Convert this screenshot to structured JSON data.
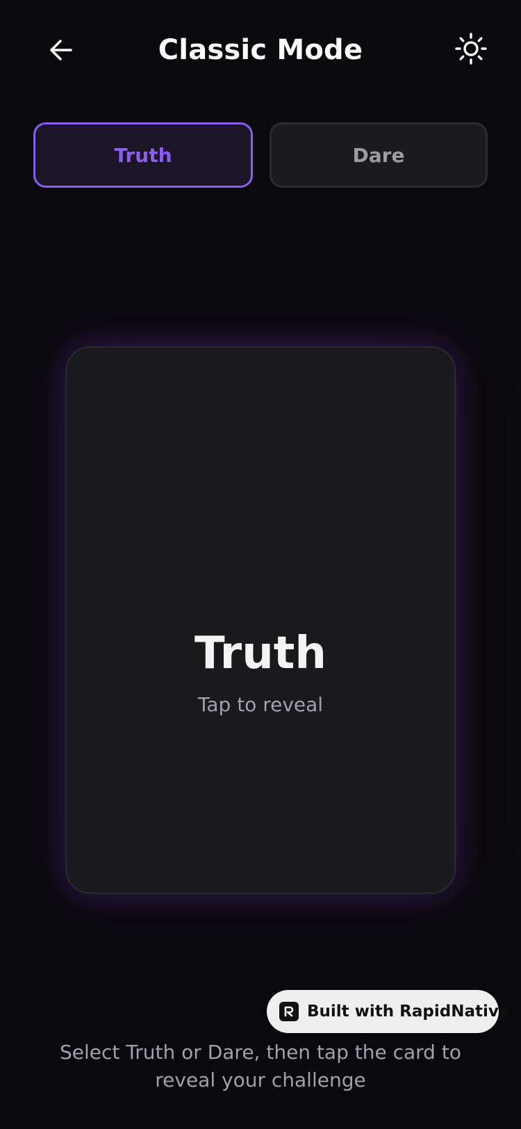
{
  "header": {
    "title": "Classic Mode",
    "back_icon": "arrow-left-icon",
    "theme_icon": "sun-icon"
  },
  "mode_toggle": {
    "truth_label": "Truth",
    "dare_label": "Dare",
    "selected": "Truth"
  },
  "card": {
    "title": "Truth",
    "subtitle": "Tap to reveal"
  },
  "badge": {
    "label": "Built with RapidNative",
    "icon": "rapidnative-logo-icon"
  },
  "footer": {
    "hint": "Select Truth or Dare, then tap the card to reveal your challenge"
  },
  "colors": {
    "background": "#0a0a0c",
    "accent": "#8b5cf6",
    "card": "#1a1a1d",
    "muted_text": "#a1a1aa"
  }
}
